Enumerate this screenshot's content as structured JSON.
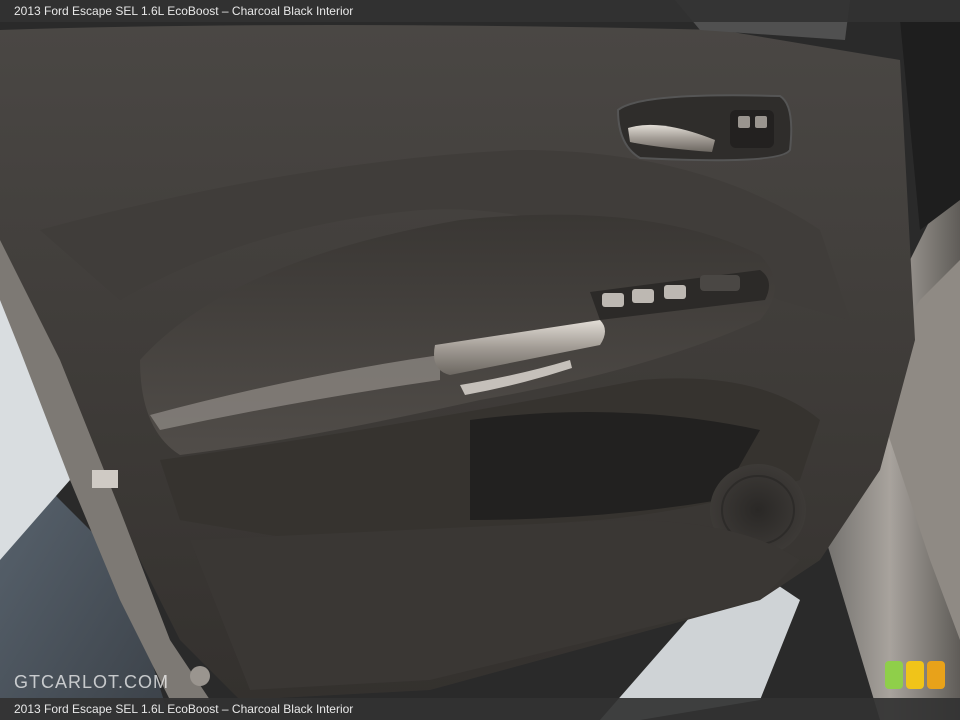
{
  "caption": {
    "top": "2013 Ford Escape SEL 1.6L EcoBoost – Charcoal Black Interior",
    "bottom": "2013 Ford Escape SEL 1.6L EcoBoost – Charcoal Black Interior"
  },
  "watermark": "GTCARLOT.COM",
  "colors": {
    "panel": "#3b3835",
    "trim": "#b9b4ae",
    "badge": [
      "#8fcf4a",
      "#f0c419",
      "#e8a21a"
    ]
  }
}
